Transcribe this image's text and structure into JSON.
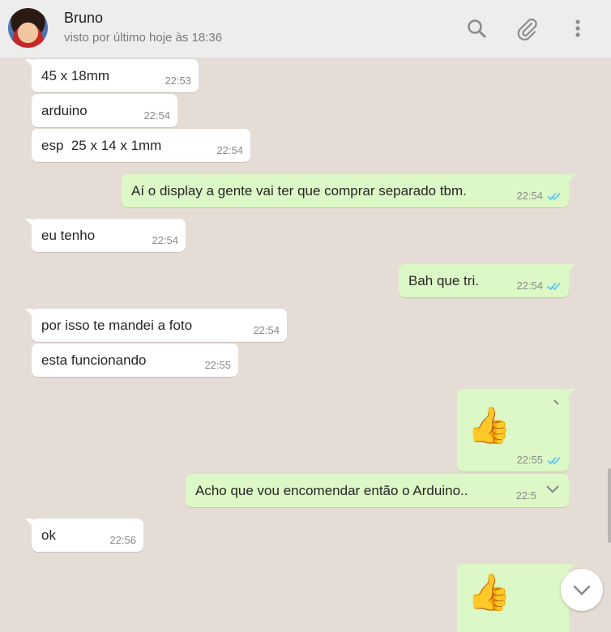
{
  "header": {
    "contact_name": "Bruno",
    "status": "visto por último hoje às 18:36"
  },
  "colors": {
    "chat_background": "#e5ddd5",
    "incoming_bubble": "#ffffff",
    "outgoing_bubble": "#dcf8c6",
    "read_ticks": "#4fc3f7"
  },
  "icons": [
    "search-icon",
    "attach-icon",
    "menu-icon",
    "scroll-down-icon",
    "thumbs-up-sticker",
    "double-check-icon"
  ],
  "messages": [
    {
      "dir": "in",
      "text": "45 x 18mm",
      "time": "22:53"
    },
    {
      "dir": "in",
      "text": "arduino",
      "time": "22:54"
    },
    {
      "dir": "in",
      "text": "esp  25 x 14 x 1mm",
      "time": "22:54"
    },
    {
      "dir": "out",
      "text": "Aí o display a gente vai ter que comprar separado tbm.",
      "time": "22:54",
      "status": "read"
    },
    {
      "dir": "in",
      "text": "eu tenho",
      "time": "22:54"
    },
    {
      "dir": "out",
      "text": "Bah que tri.",
      "time": "22:54",
      "status": "read"
    },
    {
      "dir": "in",
      "text": "por isso te mandei a foto",
      "time": "22:54"
    },
    {
      "dir": "in",
      "text": "esta funcionando",
      "time": "22:55"
    },
    {
      "dir": "out",
      "sticker": "👍",
      "time": "22:55",
      "status": "read"
    },
    {
      "dir": "out",
      "text": "Acho que vou encomendar então o Arduino..",
      "time": "22:5",
      "status": "read"
    },
    {
      "dir": "in",
      "text": "ok",
      "time": "22:56"
    },
    {
      "dir": "out",
      "sticker": "👍",
      "time": "",
      "status": ""
    }
  ]
}
